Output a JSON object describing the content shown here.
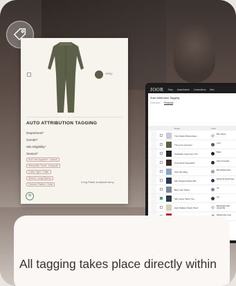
{
  "card": {
    "color_label": "Army",
    "title": "AUTO ATTRIBUTION TAGGING",
    "fields": [
      "Department*",
      "Gender*",
      "Site Eligibility*",
      "Season*"
    ],
    "pills": [
      "End Use Apparel*: Casual",
      "Silhouette Trend: Jumpsuit",
      "Collar Type: Collar",
      "Sleeve: Long Sleeve",
      "Generic Pattern: Solid"
    ],
    "right_label": "Long Pants Jumpsuit Army"
  },
  "app": {
    "logo": "JOOR",
    "nav": [
      "Shop",
      "Assortments",
      "Connections",
      "Mes"
    ],
    "title": "Auto Attribution Tagging",
    "tabs": [
      "Overview",
      "Products"
    ],
    "list_head": [
      "Name",
      "Color"
    ],
    "rows": [
      {
        "name": "The Classic Buttondown",
        "color": "Blue Stripe",
        "dot": "#c7cdd8",
        "checked": false
      },
      {
        "name": "The Luna Jumpsuit",
        "color": "Army",
        "dot": "#5c5d44",
        "checked": false
      },
      {
        "name": "Stackable Cashmere Turt",
        "color": "Black",
        "dot": "#222",
        "checked": false
      },
      {
        "name": "Crew Neck Sweatshirt",
        "color": "Dark Chocolate",
        "dot": "#3b2a22",
        "checked": false
      },
      {
        "name": "Wire Mini Bag",
        "color": "Blue Buttercream",
        "dot": "#8ba5c9",
        "checked": false
      },
      {
        "name": "Silk Snapped Wrap Mid",
        "color": "Botanical Royal Navy",
        "dot": "#2a3a5a",
        "checked": false
      },
      {
        "name": "Barry Zen Plaza",
        "color": "Ink",
        "dot": "#7d8c9a",
        "checked": false
      },
      {
        "name": "Silk Center Skirm Top",
        "color": "Ink",
        "dot": "#2b3a4a",
        "checked": true
      },
      {
        "name": "High Waisted Study Short",
        "color": "BEACHED AND SHADOW",
        "dot": "#d8cfb8",
        "checked": false
      },
      {
        "name": "",
        "color": "Rattlesnake Logo",
        "dot": "#c02020",
        "checked": false
      }
    ]
  },
  "headline": "All tagging takes place directly within"
}
